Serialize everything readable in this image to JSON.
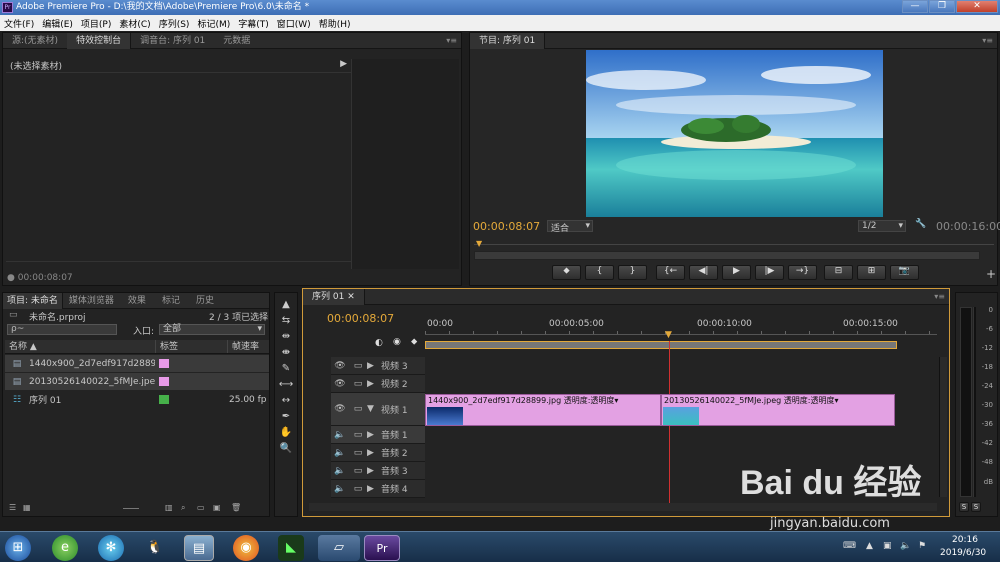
{
  "app": {
    "title": "Adobe Premiere Pro - D:\\我的文档\\Adobe\\Premiere Pro\\6.0\\未命名 *",
    "logo": "Pr"
  },
  "window_buttons": [
    "—",
    "❐",
    "✕"
  ],
  "menu": [
    "文件(F)",
    "编辑(E)",
    "项目(P)",
    "素材(C)",
    "序列(S)",
    "标记(M)",
    "字幕(T)",
    "窗口(W)",
    "帮助(H)"
  ],
  "source_panel": {
    "tabs": [
      "源:(无素材)",
      "特效控制台",
      "调音台: 序列 01",
      "元数据"
    ],
    "no_clip": "(未选择素材)",
    "timecode": "00:00:08:07"
  },
  "program_panel": {
    "tab": "节目: 序列 01",
    "timecode": "00:00:08:07",
    "fit": "适合",
    "resolution": "1/2",
    "duration": "00:00:16:00",
    "buttons": [
      "⬥",
      "{",
      "}",
      "{←",
      "◀|",
      "▶",
      "|▶",
      "→}",
      "⊟",
      "⊞",
      "📷"
    ],
    "colors": {
      "sky_top": "#2f6fc9",
      "sky_bottom": "#a8d4f0",
      "sea": "#2fb3b8",
      "sand": "#f2ecd6",
      "island": "#2c6b2a"
    }
  },
  "project_panel": {
    "tabs": [
      "项目: 未命名",
      "媒体浏览器",
      "效果",
      "标记",
      "历史"
    ],
    "file": "未命名.prproj",
    "selected": "2 / 3 项已选择",
    "search_placeholder": "ρ~",
    "inlet_label": "入口:",
    "inlet_value": "全部",
    "columns": [
      "名称",
      "标签",
      "帧速率"
    ],
    "items": [
      {
        "name": "1440x900_2d7edf917d28899",
        "label_color": "#e89ae8",
        "fps": ""
      },
      {
        "name": "20130526140022_5fMJe.jpeg",
        "label_color": "#e89ae8",
        "fps": ""
      },
      {
        "name": "序列 01",
        "label_color": "#46b04a",
        "fps": "25.00 fp"
      }
    ]
  },
  "tools": [
    "▲",
    "⇆",
    "⇹",
    "⇼",
    "✎",
    "⟷",
    "↔",
    "✒",
    "✋",
    "🔍"
  ],
  "timeline": {
    "tab": "序列 01",
    "timecode": "00:00:08:07",
    "ruler": [
      "00:00",
      "00:00:05:00",
      "00:00:10:00",
      "00:00:15:00"
    ],
    "video_tracks": [
      "视频 3",
      "视频 2",
      "视频 1"
    ],
    "audio_tracks": [
      "音频 1",
      "音频 2",
      "音频 3",
      "音频 4"
    ],
    "clips": [
      {
        "name": "1440x900_2d7edf917d28899.jpg",
        "effect": "透明度:透明度"
      },
      {
        "name": "20130526140022_5fMJe.jpeg",
        "effect": "透明度:透明度"
      }
    ]
  },
  "vu_meter": {
    "ticks": [
      "0",
      "-6",
      "-12",
      "-18",
      "-24",
      "-30",
      "-36",
      "-42",
      "-48",
      "dB"
    ],
    "solo": [
      "S",
      "S"
    ]
  },
  "watermark": {
    "brand": "Bai du 经验",
    "url": "jingyan.baidu.com"
  },
  "taskbar": {
    "time": "20:16",
    "date": "2019/6/30"
  }
}
